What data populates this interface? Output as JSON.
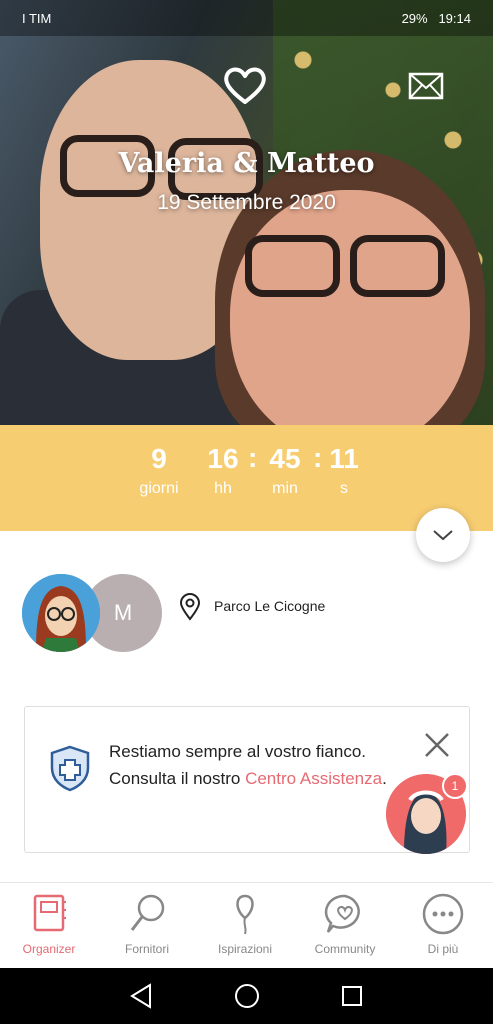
{
  "status_bar": {
    "carrier": "I TIM",
    "battery": "29%",
    "time": "19:14"
  },
  "hero": {
    "title": "Valeria & Matteo",
    "date": "19 Settembre 2020"
  },
  "countdown": [
    {
      "value": "9",
      "label": "giorni"
    },
    {
      "value": "16",
      "label": "hh"
    },
    {
      "value": "45",
      "label": "min"
    },
    {
      "value": "11",
      "label": "s"
    }
  ],
  "couple": {
    "partner_initial": "M",
    "venue": "Parco Le Cicogne"
  },
  "info_card": {
    "text_line1": "Restiamo sempre al vostro fianco.",
    "text_line2": "Consulta il nostro ",
    "link": "Centro Assistenza",
    "period": ".",
    "badge_count": "1"
  },
  "tabs": [
    {
      "label": "Organizer",
      "icon": "notebook-icon",
      "active": true
    },
    {
      "label": "Fornitori",
      "icon": "search-icon",
      "active": false
    },
    {
      "label": "Ispirazioni",
      "icon": "balloon-icon",
      "active": false
    },
    {
      "label": "Community",
      "icon": "chat-heart-icon",
      "active": false
    },
    {
      "label": "Di più",
      "icon": "more-icon",
      "active": false
    }
  ],
  "colors": {
    "accent": "#e56a72",
    "countdown_bg": "#f7cd72"
  }
}
